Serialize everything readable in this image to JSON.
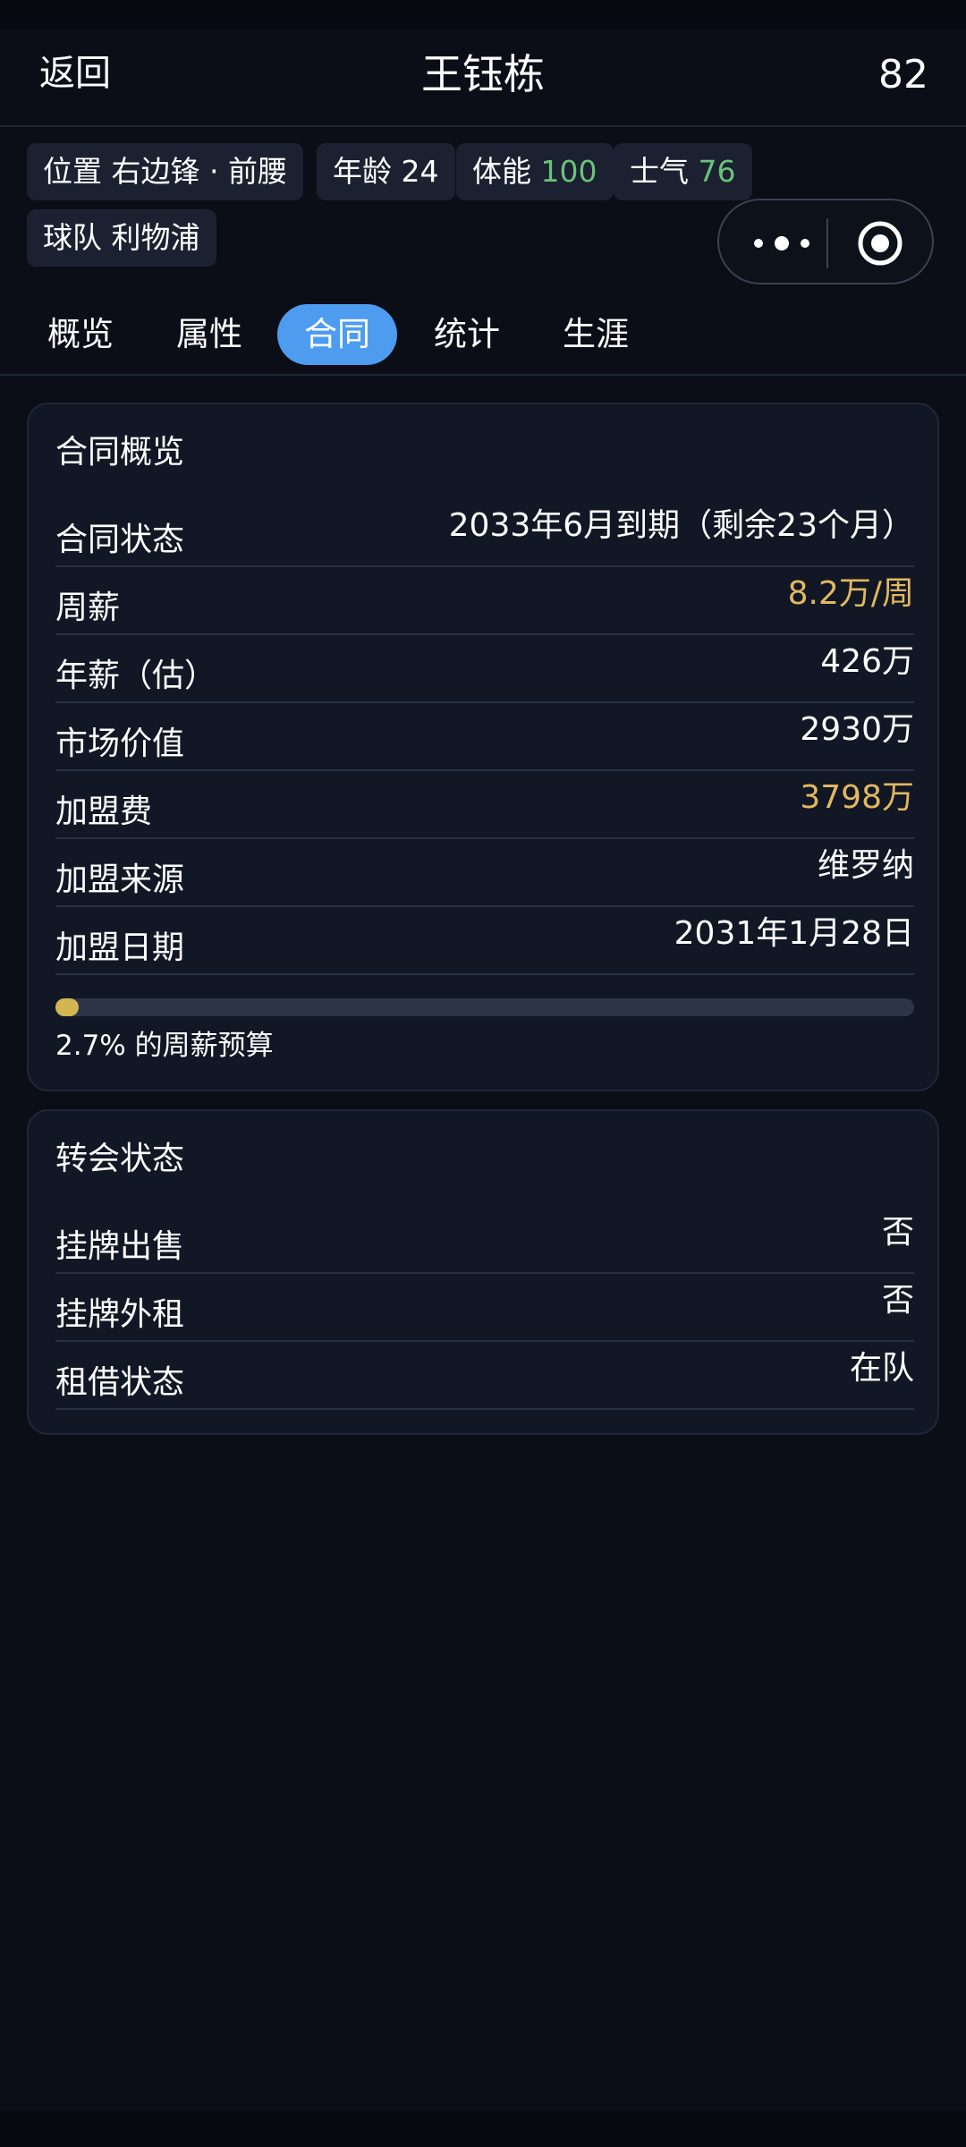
{
  "header": {
    "back_label": "返回",
    "player_name": "王钰栋",
    "rating": "82"
  },
  "chips": {
    "position": {
      "label": "位置",
      "value": "右边锋 · 前腰"
    },
    "age": {
      "label": "年龄",
      "value": "24"
    },
    "fitness": {
      "label": "体能",
      "value": "100"
    },
    "morale": {
      "label": "士气",
      "value": "76"
    },
    "team": {
      "label": "球队",
      "value": "利物浦"
    }
  },
  "capsule": {
    "more_icon": "more-dots-icon",
    "close_icon": "target-circle-icon"
  },
  "tabs": [
    {
      "label": "概览",
      "active": false
    },
    {
      "label": "属性",
      "active": false
    },
    {
      "label": "合同",
      "active": true
    },
    {
      "label": "统计",
      "active": false
    },
    {
      "label": "生涯",
      "active": false
    }
  ],
  "contract": {
    "title": "合同概览",
    "rows": [
      {
        "key": "合同状态",
        "value": "2033年6月到期（剩余23个月）",
        "highlight": false
      },
      {
        "key": "周薪",
        "value": "8.2万/周",
        "highlight": true
      },
      {
        "key": "年薪（估）",
        "value": "426万",
        "highlight": false
      },
      {
        "key": "市场价值",
        "value": "2930万",
        "highlight": false
      },
      {
        "key": "加盟费",
        "value": "3798万",
        "highlight": true
      },
      {
        "key": "加盟来源",
        "value": "维罗纳",
        "highlight": false
      },
      {
        "key": "加盟日期",
        "value": "2031年1月28日",
        "highlight": false
      }
    ],
    "budget_percent": 2.7,
    "budget_text": "2.7% 的周薪预算"
  },
  "transfer": {
    "title": "转会状态",
    "rows": [
      {
        "key": "挂牌出售",
        "value": "否"
      },
      {
        "key": "挂牌外租",
        "value": "否"
      },
      {
        "key": "租借状态",
        "value": "在队"
      }
    ]
  },
  "colors": {
    "accent": "#4d9cf0",
    "gold": "#e2b85f",
    "green": "#6ac27a",
    "progress": "#d3b552"
  }
}
